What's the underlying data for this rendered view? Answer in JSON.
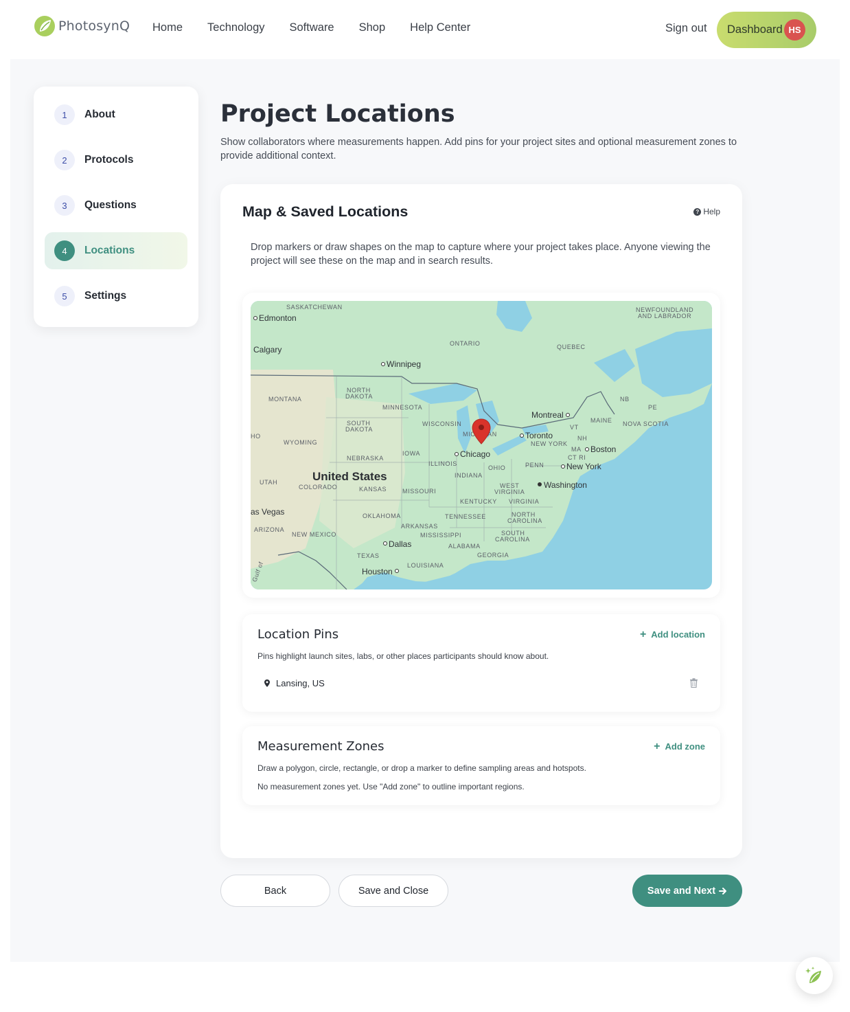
{
  "header": {
    "brand": "PhotosynQ",
    "nav": [
      "Home",
      "Technology",
      "Software",
      "Shop",
      "Help Center"
    ],
    "sign_out": "Sign out",
    "dashboard": "Dashboard",
    "avatar_initials": "HS"
  },
  "stepper": {
    "steps": [
      {
        "num": "1",
        "label": "About"
      },
      {
        "num": "2",
        "label": "Protocols"
      },
      {
        "num": "3",
        "label": "Questions"
      },
      {
        "num": "4",
        "label": "Locations"
      },
      {
        "num": "5",
        "label": "Settings"
      }
    ],
    "active": 4
  },
  "main": {
    "title": "Project Locations",
    "description": "Show collaborators where measurements happen. Add pins for your project sites and optional measurement zones to provide additional context."
  },
  "map_card": {
    "title": "Map & Saved Locations",
    "help": "Help",
    "description": "Drop markers or draw shapes on the map to capture where your project takes place. Anyone viewing the project will see these on the map and in search results.",
    "map_labels": {
      "regions": [
        "SASKATCHEWAN",
        "NEWFOUNDLAND",
        "AND LABRADOR",
        "ONTARIO",
        "QUEBEC",
        "NORTH",
        "DAKOTA",
        "MONTANA",
        "MINNESOTA",
        "SOUTH",
        "DAKOTA",
        "WISCONSIN",
        "MICHIGAN",
        "NB",
        "PE",
        "MAINE",
        "NOVA SCOTIA",
        "VT",
        "NH",
        "NEW YORK",
        "MA",
        "CT RI",
        "WYOMING",
        "IOWA",
        "NEBRASKA",
        "ILLINOIS",
        "OHIO",
        "PENN",
        "INDIANA",
        "UTAH",
        "COLORADO",
        "KANSAS",
        "MISSOURI",
        "WEST",
        "VIRGINIA",
        "KENTUCKY",
        "VIRGINIA",
        "OKLAHOMA",
        "TENNESSEE",
        "NORTH",
        "CAROLINA",
        "ARIZONA",
        "NEW MEXICO",
        "ARKANSAS",
        "MISSISSIPPI",
        "SOUTH",
        "CAROLINA",
        "ALABAMA",
        "GEORGIA",
        "TEXAS",
        "LOUISIANA",
        "HO",
        "Gulf of"
      ],
      "country": "United States",
      "cities": [
        "Edmonton",
        "Calgary",
        "Winnipeg",
        "Montreal",
        "Toronto",
        "Boston",
        "Chicago",
        "New York",
        "Washington",
        "as Vegas",
        "Dallas",
        "Houston"
      ]
    }
  },
  "location_pins": {
    "title": "Location Pins",
    "add": "Add location",
    "description": "Pins highlight launch sites, labs, or other places participants should know about.",
    "items": [
      {
        "label": "Lansing, US"
      }
    ]
  },
  "measurement_zones": {
    "title": "Measurement Zones",
    "add": "Add zone",
    "description": "Draw a polygon, circle, rectangle, or drop a marker to define sampling areas and hotspots.",
    "empty": "No measurement zones yet. Use \"Add zone\" to outline important regions."
  },
  "footer": {
    "back": "Back",
    "save_close": "Save and Close",
    "save_next": "Save and Next"
  },
  "colors": {
    "accent": "#3f8f80",
    "dashboard_start": "#c9dc6e",
    "dashboard_end": "#a8cc6a",
    "avatar": "#d9534f",
    "marker": "#d9342b",
    "water": "#8fd0e4",
    "land": "#c3e6c8"
  },
  "icons": [
    "logo-leaf-icon",
    "help-circle-icon",
    "plus-icon",
    "map-pin-icon",
    "trash-icon",
    "arrow-right-icon",
    "assistant-leaf-icon",
    "map-marker-icon"
  ]
}
